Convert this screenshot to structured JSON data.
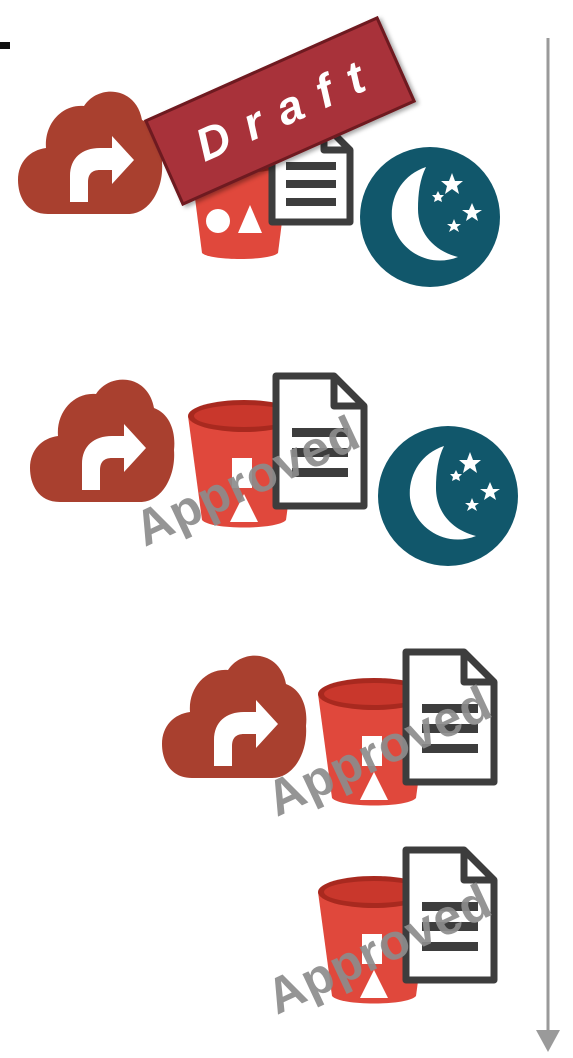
{
  "diagram": {
    "colors": {
      "cloud": "#a9402f",
      "bucket": "#e0483c",
      "bucket_dark": "#a8291f",
      "document_stroke": "#3d3d3d",
      "moon_badge": "#11576b",
      "draft_banner": "#a8323a",
      "stamp_text": "#8c8c8c",
      "timeline": "#9a9a9a"
    },
    "draft_label": "Draft",
    "stages": [
      {
        "status": "Draft",
        "icons": [
          "cloud-upload-icon",
          "bucket-icon",
          "document-icon",
          "moon-icon"
        ]
      },
      {
        "status": "Approved",
        "icons": [
          "cloud-upload-icon",
          "bucket-icon",
          "document-icon",
          "moon-icon"
        ]
      },
      {
        "status": "Approved",
        "icons": [
          "cloud-upload-icon",
          "bucket-icon",
          "document-icon"
        ]
      },
      {
        "status": "Approved",
        "icons": [
          "bucket-icon",
          "document-icon"
        ]
      }
    ],
    "timeline": {
      "direction": "down"
    }
  }
}
